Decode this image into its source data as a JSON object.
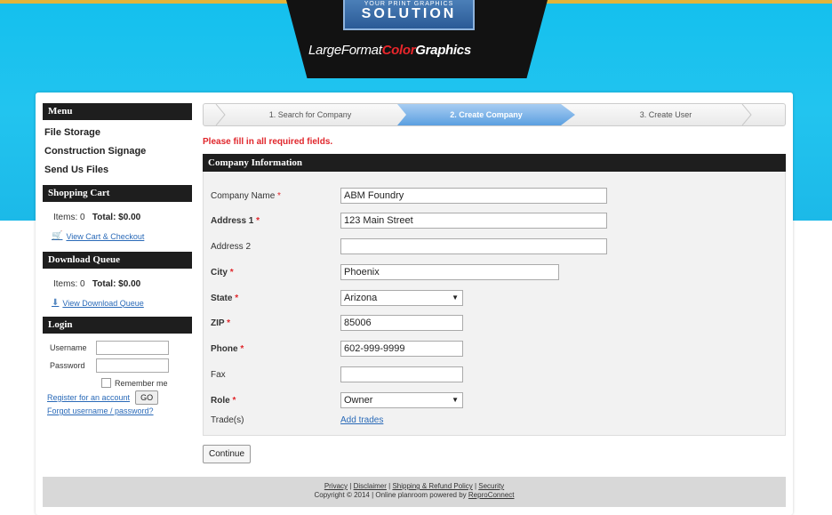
{
  "header": {
    "logo_small": "YOUR PRINT GRAPHICS",
    "logo_big": "SOLUTION",
    "tag_part1": "LargeFormat",
    "tag_part2": "Color",
    "tag_part3": "Graphics"
  },
  "sidebar": {
    "menu_title": "Menu",
    "menu_items": [
      "File Storage",
      "Construction Signage",
      "Send Us Files"
    ],
    "cart_title": "Shopping Cart",
    "cart_items_label": "Items: 0",
    "cart_total_label": "Total: $0.00",
    "cart_link": "View Cart & Checkout",
    "queue_title": "Download Queue",
    "queue_items_label": "Items: 0",
    "queue_total_label": "Total: $0.00",
    "queue_link": "View Download Queue",
    "login_title": "Login",
    "username_label": "Username",
    "password_label": "Password",
    "remember_label": "Remember me",
    "register_link": "Register for an account",
    "go_label": "GO",
    "forgot_link": "Forgot username / password?"
  },
  "steps": [
    "1. Search for Company",
    "2. Create Company",
    "3. Create User"
  ],
  "required_msg": "Please fill in all required fields.",
  "section_title": "Company Information",
  "form": {
    "company_name": {
      "label": "Company Name",
      "value": "ABM Foundry"
    },
    "address1": {
      "label": "Address 1",
      "value": "123 Main Street"
    },
    "address2": {
      "label": "Address 2",
      "value": ""
    },
    "city": {
      "label": "City",
      "value": "Phoenix"
    },
    "state": {
      "label": "State",
      "value": "Arizona"
    },
    "zip": {
      "label": "ZIP",
      "value": "85006"
    },
    "phone": {
      "label": "Phone",
      "value": "602-999-9999"
    },
    "fax": {
      "label": "Fax",
      "value": ""
    },
    "role": {
      "label": "Role",
      "value": "Owner"
    },
    "trades": {
      "label": "Trade(s)",
      "link": "Add trades"
    }
  },
  "continue_label": "Continue",
  "footer": {
    "links": [
      "Privacy",
      "Disclaimer",
      "Shipping & Refund Policy",
      "Security"
    ],
    "copyright": "Copyright © 2014 | Online planroom powered by",
    "powered_link": "ReproConnect"
  },
  "colors": {
    "sky": "#1cbfed",
    "active_step": "#5b9fe0",
    "required": "#e0262b",
    "link": "#2a6ab8"
  }
}
